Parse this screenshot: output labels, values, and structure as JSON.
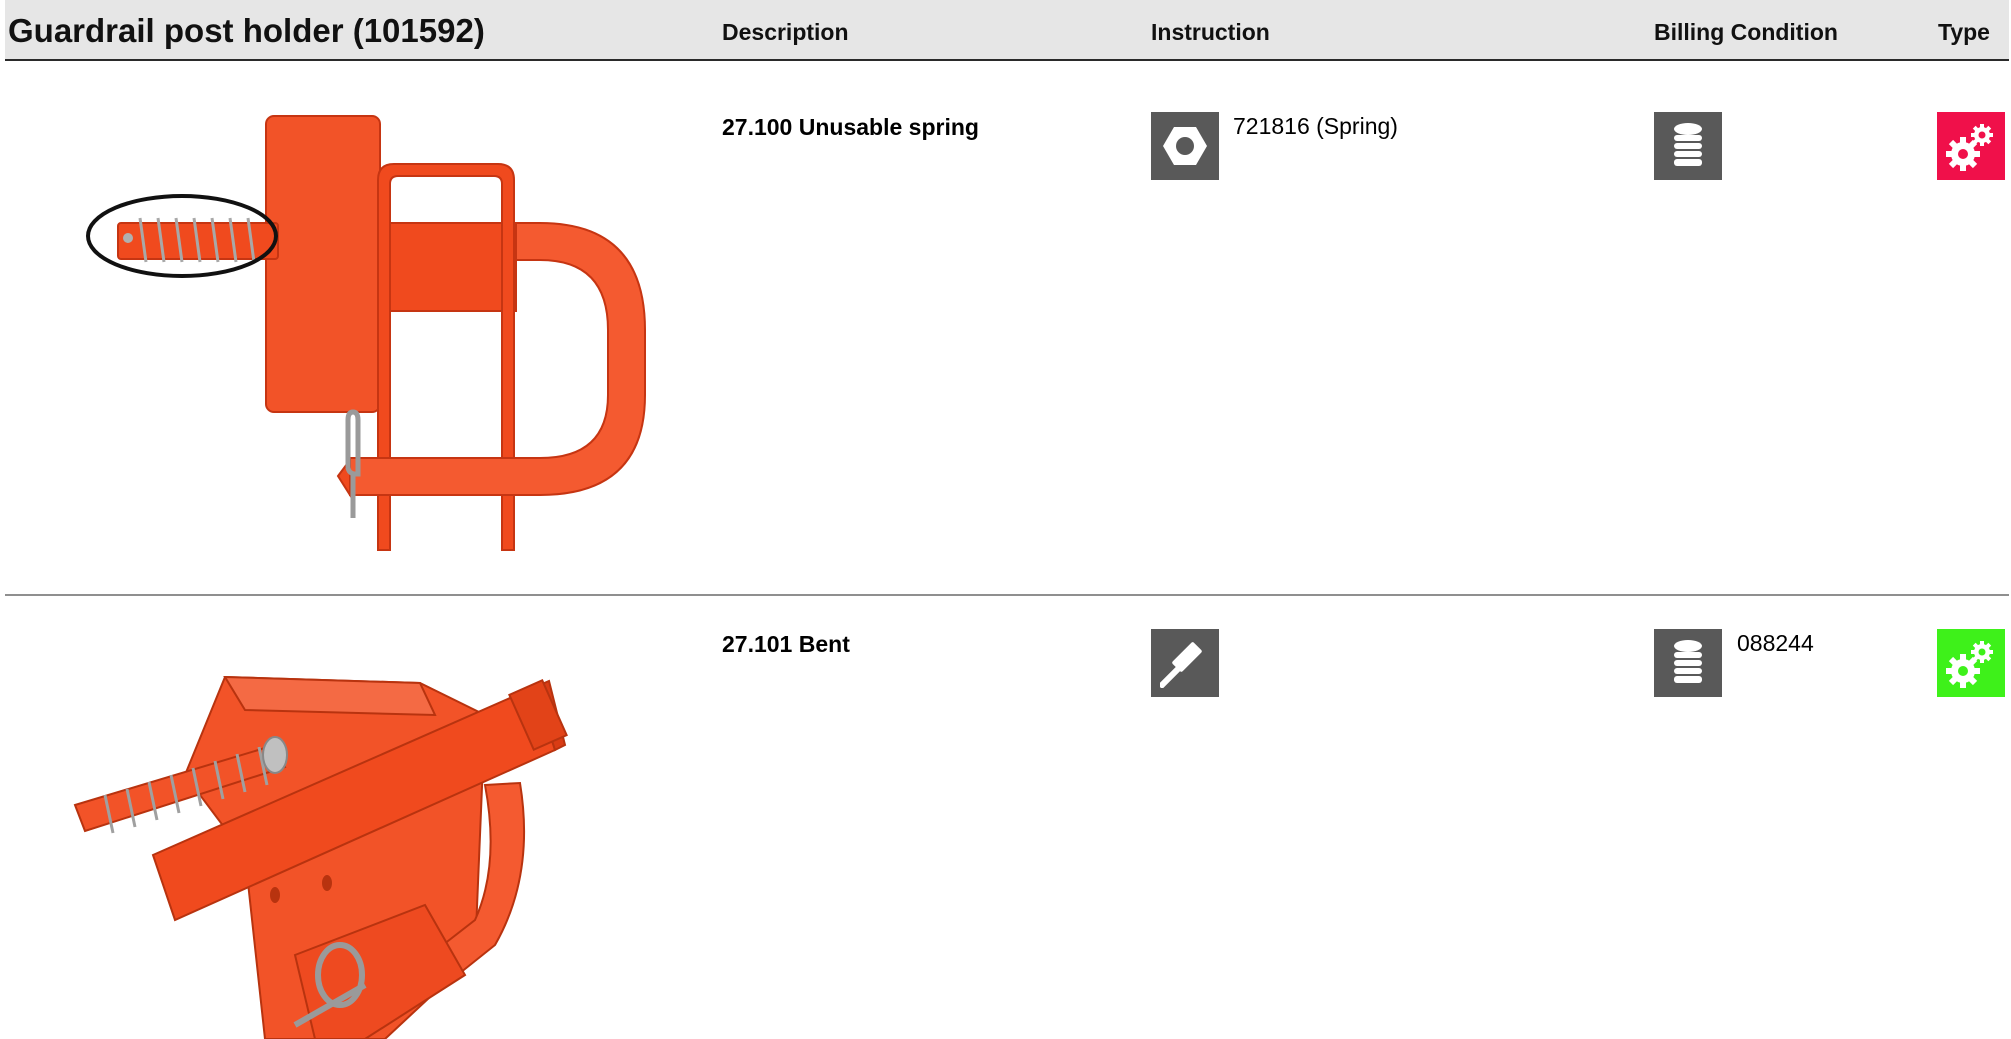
{
  "header": {
    "title": "Guardrail post holder (101592)",
    "columns": {
      "description": "Description",
      "instruction": "Instruction",
      "billing": "Billing Condition",
      "type": "Type"
    }
  },
  "rows": [
    {
      "description": "27.100 Unusable spring",
      "instruction_icon": "nut-icon",
      "instruction_text": "721816 (Spring)",
      "billing_icon": "coin-stack-icon",
      "billing_text": "",
      "type_icon": "gears-icon",
      "type_color": "#f0104a"
    },
    {
      "description": "27.101 Bent",
      "instruction_icon": "hammer-icon",
      "instruction_text": "",
      "billing_icon": "coin-stack-icon",
      "billing_text": "088244",
      "type_icon": "gears-icon",
      "type_color": "#3ef11a"
    }
  ],
  "colors": {
    "part_orange": "#f04a1e",
    "icon_gray": "#595959",
    "header_bg": "#e6e6e6"
  }
}
